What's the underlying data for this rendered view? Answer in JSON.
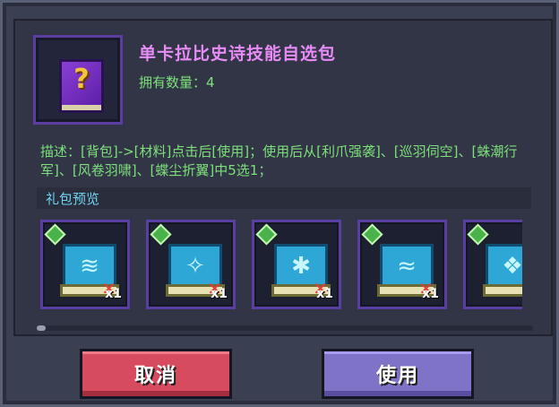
{
  "pack": {
    "title": "单卡拉比史诗技能自选包",
    "owned_text": "拥有数量：4",
    "icon": "purple-mystery-book-icon"
  },
  "description": "描述：[背包]->[材料]点击后[使用]；使用后从[利爪强袭]、[巡羽伺空]、[蛛潮行军]、[风卷羽啸]、[蝶尘折翼]中5选1；",
  "preview": {
    "label": "礼包预览",
    "items": [
      {
        "icon": "claw-strike-scroll-icon",
        "glyph": "≋",
        "qty": "x1"
      },
      {
        "icon": "wing-patrol-scroll-icon",
        "glyph": "✧",
        "qty": "x1"
      },
      {
        "icon": "spider-march-scroll-icon",
        "glyph": "✱",
        "qty": "x1"
      },
      {
        "icon": "wind-feather-scroll-icon",
        "glyph": "≈",
        "qty": "x1"
      },
      {
        "icon": "butterfly-wing-scroll-icon",
        "glyph": "❖",
        "qty": ""
      }
    ]
  },
  "buttons": {
    "cancel": "取消",
    "use": "使用"
  },
  "colors": {
    "title": "#e78cf6",
    "green_text": "#7de07a",
    "preview_label": "#6fd5f0",
    "cancel_btn": "#d64b5d",
    "use_btn": "#7f73c8",
    "card_border": "#5a3fa2"
  }
}
